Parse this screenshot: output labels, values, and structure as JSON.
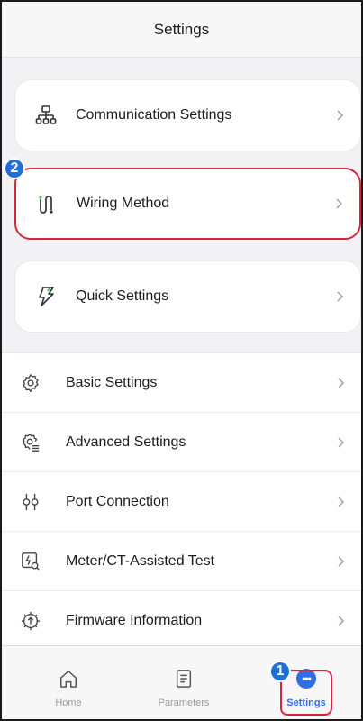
{
  "header": {
    "title": "Settings"
  },
  "cards": [
    {
      "label": "Communication Settings",
      "icon": "network-icon"
    },
    {
      "label": "Wiring Method",
      "icon": "wiring-icon"
    },
    {
      "label": "Quick Settings",
      "icon": "lightning-icon"
    }
  ],
  "list": [
    {
      "label": "Basic Settings",
      "icon": "gear-icon"
    },
    {
      "label": "Advanced Settings",
      "icon": "advanced-gear-icon"
    },
    {
      "label": "Port Connection",
      "icon": "port-icon"
    },
    {
      "label": "Meter/CT-Assisted Test",
      "icon": "meter-test-icon"
    },
    {
      "label": "Firmware Information",
      "icon": "firmware-icon"
    }
  ],
  "tabs": [
    {
      "label": "Home",
      "icon": "home-icon"
    },
    {
      "label": "Parameters",
      "icon": "document-icon"
    },
    {
      "label": "Settings",
      "icon": "more-dots-icon"
    }
  ],
  "annotations": {
    "step1": "1",
    "step2": "2"
  },
  "colors": {
    "accent": "#2f6fe8",
    "highlight": "#d9253b",
    "badge": "#1e6fd9"
  }
}
